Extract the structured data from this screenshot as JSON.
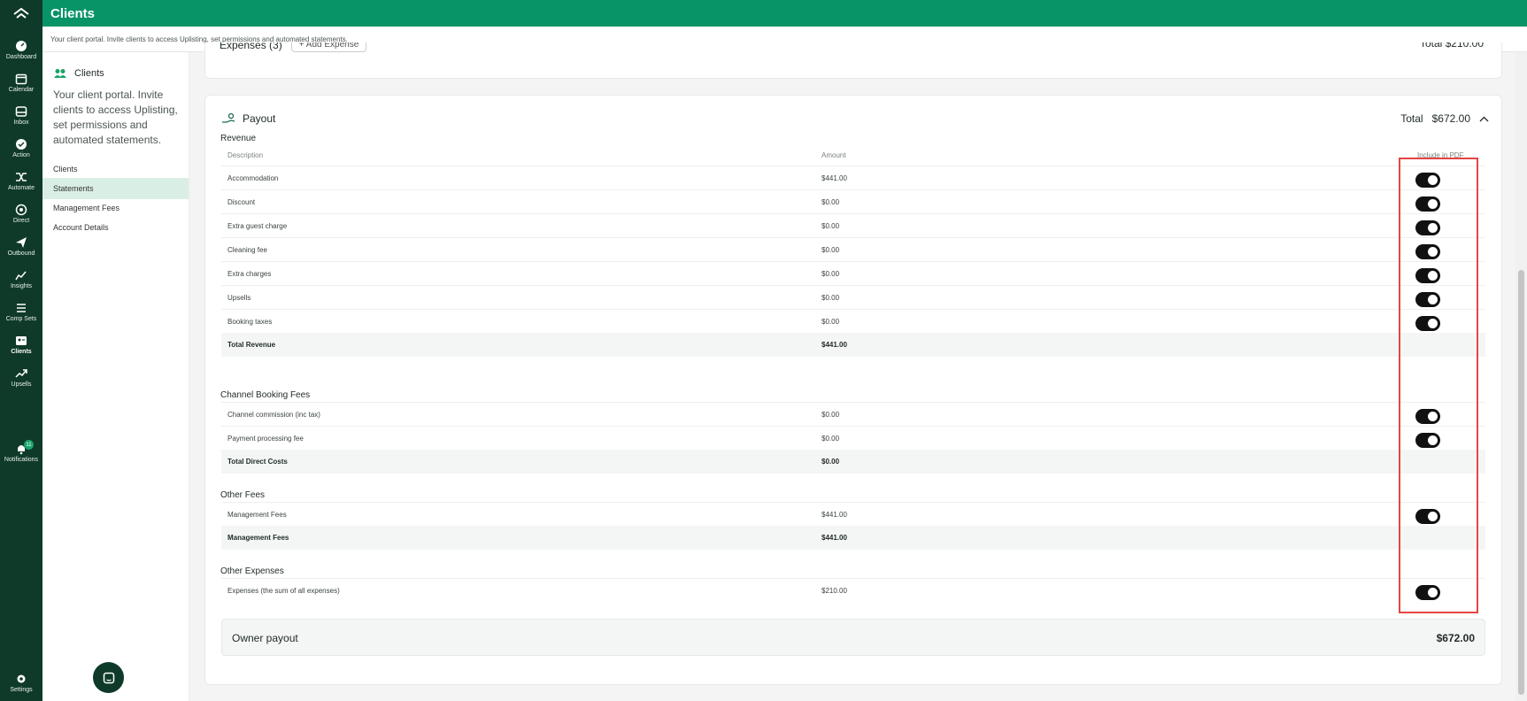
{
  "nav": {
    "items": [
      {
        "label": "Dashboard"
      },
      {
        "label": "Calendar"
      },
      {
        "label": "Inbox"
      },
      {
        "label": "Action"
      },
      {
        "label": "Automate"
      },
      {
        "label": "Direct"
      },
      {
        "label": "Outbound"
      },
      {
        "label": "Insights"
      },
      {
        "label": "Comp Sets"
      },
      {
        "label": "Clients"
      },
      {
        "label": "Upsells"
      },
      {
        "label": "Notifications",
        "badge": "11"
      },
      {
        "label": "Settings"
      }
    ],
    "active": "Clients"
  },
  "header": {
    "title": "Clients",
    "subtitle": "Your client portal. Invite clients to access Uplisting, set permissions and automated statements."
  },
  "sidebar": {
    "title": "Clients",
    "description": "Your client portal. Invite clients to access Uplisting, set permissions and automated statements.",
    "links": [
      {
        "label": "Clients"
      },
      {
        "label": "Statements"
      },
      {
        "label": "Management Fees"
      },
      {
        "label": "Account Details"
      }
    ],
    "active": "Statements"
  },
  "expenses_card": {
    "title": "Expenses (3)",
    "add_button": "+ Add Expense",
    "total": "Total   $210.00"
  },
  "payout": {
    "title": "Payout",
    "total_label": "Total",
    "total_value": "$672.00",
    "columns": {
      "description": "Description",
      "amount": "Amount",
      "include_pdf": "Include in PDF"
    },
    "sections": [
      {
        "title": "Revenue",
        "rows": [
          {
            "desc": "Accommodation",
            "amount": "$441.00",
            "include": true
          },
          {
            "desc": "Discount",
            "amount": "$0.00",
            "include": true
          },
          {
            "desc": "Extra guest charge",
            "amount": "$0.00",
            "include": true
          },
          {
            "desc": "Cleaning fee",
            "amount": "$0.00",
            "include": true
          },
          {
            "desc": "Extra charges",
            "amount": "$0.00",
            "include": true
          },
          {
            "desc": "Upsells",
            "amount": "$0.00",
            "include": true
          },
          {
            "desc": "Booking taxes",
            "amount": "$0.00",
            "include": true
          }
        ],
        "total": {
          "desc": "Total Revenue",
          "amount": "$441.00"
        }
      },
      {
        "title": "Channel Booking Fees",
        "rows": [
          {
            "desc": "Channel commission (inc tax)",
            "amount": "$0.00",
            "include": true
          },
          {
            "desc": "Payment processing fee",
            "amount": "$0.00",
            "include": true
          }
        ],
        "total": {
          "desc": "Total Direct Costs",
          "amount": "$0.00"
        }
      },
      {
        "title": "Other Fees",
        "rows": [
          {
            "desc": "Management Fees",
            "amount": "$441.00",
            "include": true
          }
        ],
        "total": {
          "desc": "Management Fees",
          "amount": "$441.00"
        }
      },
      {
        "title": "Other Expenses",
        "rows": [
          {
            "desc": "Expenses (the sum of all expenses)",
            "amount": "$210.00",
            "include": true
          }
        ]
      }
    ],
    "owner_payout_label": "Owner payout",
    "owner_payout_value": "$672.00"
  },
  "colors": {
    "brand": "#089467",
    "rail": "#0f3a2a",
    "highlight": "#e64545"
  }
}
